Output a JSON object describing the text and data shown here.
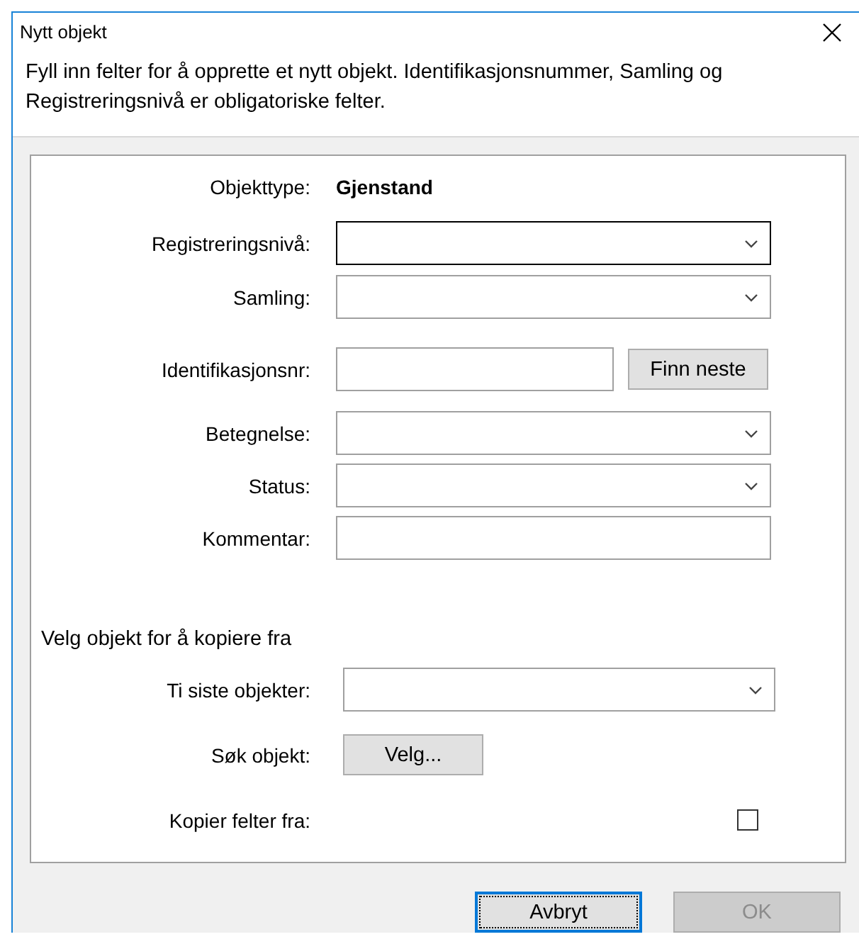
{
  "window": {
    "title": "Nytt objekt"
  },
  "description": "Fyll inn felter for å opprette et nytt objekt. Identifikasjonsnummer, Samling og Registreringsnivå er obligatoriske felter.",
  "object_type": {
    "label": "Objekttype:",
    "value": "Gjenstand"
  },
  "fields": [
    {
      "kind": "combo",
      "label": "Registreringsnivå:",
      "focused": true
    },
    {
      "kind": "combo",
      "label": "Samling:",
      "focused": false
    },
    {
      "kind": "text_with_button",
      "label": "Identifikasjonsnr:",
      "button": "Finn neste",
      "focused": false
    },
    {
      "kind": "combo",
      "label": "Betegnelse:",
      "focused": false
    },
    {
      "kind": "combo",
      "label": "Status:",
      "focused": false
    },
    {
      "kind": "text",
      "label": "Kommentar:",
      "focused": false
    }
  ],
  "copy_section": {
    "title": "Velg objekt for å kopiere fra",
    "fields": [
      {
        "kind": "combo",
        "label": "Ti siste objekter:"
      },
      {
        "kind": "button",
        "label": "Søk objekt:",
        "button": "Velg..."
      },
      {
        "kind": "checkbox",
        "label": "Kopier felter fra:",
        "checked": false
      }
    ]
  },
  "buttons": [
    {
      "label": "Avbryt",
      "default": true,
      "disabled": false
    },
    {
      "label": "OK",
      "default": false,
      "disabled": true
    }
  ]
}
